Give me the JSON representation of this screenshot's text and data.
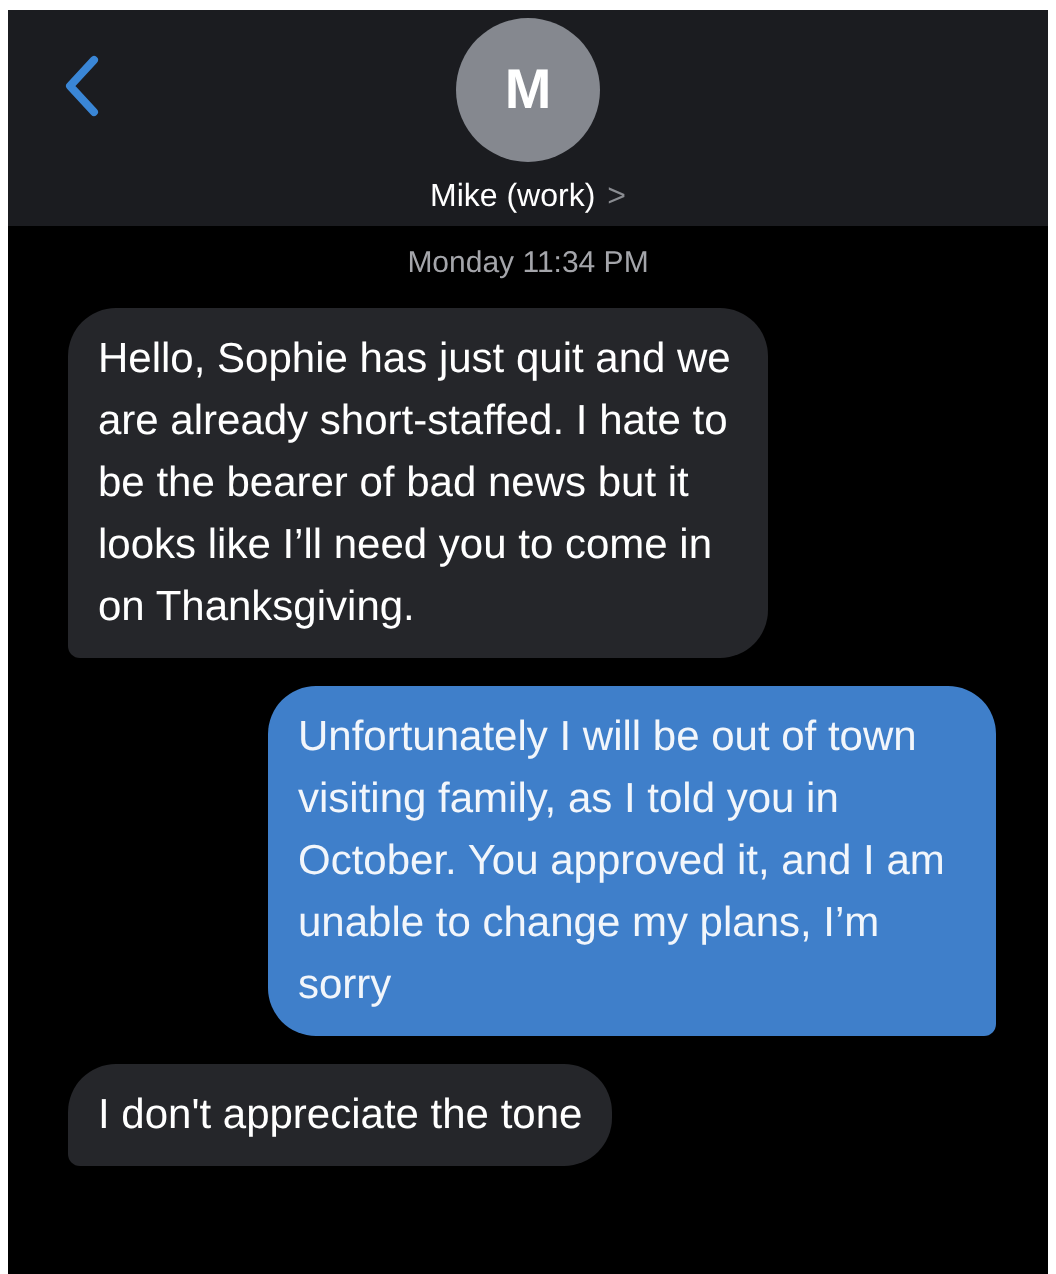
{
  "header": {
    "avatar_initial": "M",
    "contact_name": "Mike (work)",
    "chevron": ">"
  },
  "timestamp": "Monday 11:34 PM",
  "messages": [
    {
      "kind": "received",
      "text": "Hello, Sophie has just quit and we are already short-staffed. I hate to be the bearer of bad news but it looks like I’ll need you to come in on Thanksgiving."
    },
    {
      "kind": "sent",
      "text": "Unfortunately I will be out of town visiting family, as I told you in October. You approved it, and I am unable to change my plans, I’m sorry"
    },
    {
      "kind": "received",
      "text": "I don't appreciate the tone"
    }
  ]
}
